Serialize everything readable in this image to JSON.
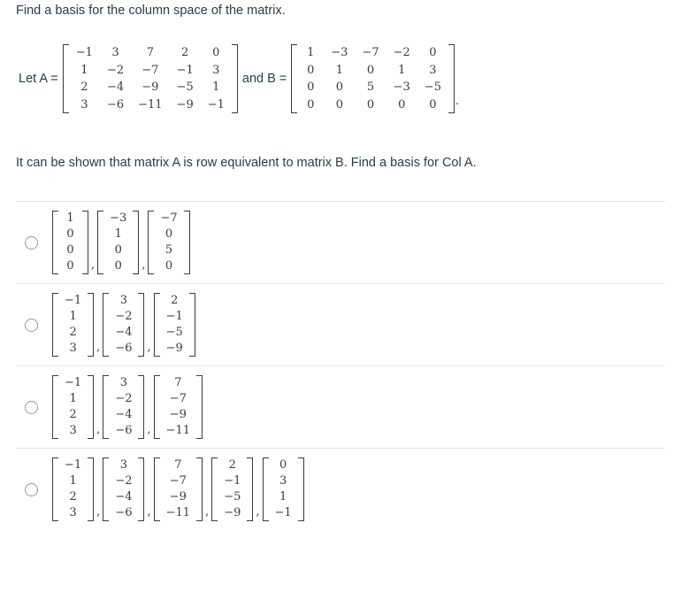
{
  "prompt": {
    "title": "Find a basis for the column space of the matrix.",
    "instruction": "It can be shown that matrix A is row equivalent to matrix B. Find a basis for Col A."
  },
  "definition": {
    "let_label": "Let A =",
    "and_label": "and B =",
    "period": ".",
    "matrix_a": [
      [
        "−1",
        "3",
        "7",
        "2",
        "0"
      ],
      [
        "1",
        "−2",
        "−7",
        "−1",
        "3"
      ],
      [
        "2",
        "−4",
        "−9",
        "−5",
        "1"
      ],
      [
        "3",
        "−6",
        "−11",
        "−9",
        "−1"
      ]
    ],
    "matrix_b": [
      [
        "1",
        "−3",
        "−7",
        "−2",
        "0"
      ],
      [
        "0",
        "1",
        "0",
        "1",
        "3"
      ],
      [
        "0",
        "0",
        "5",
        "−3",
        "−5"
      ],
      [
        "0",
        "0",
        "0",
        "0",
        "0"
      ]
    ]
  },
  "separator": ",",
  "choices": [
    {
      "selected": false,
      "vectors": [
        [
          "1",
          "0",
          "0",
          "0"
        ],
        [
          "−3",
          "1",
          "0",
          "0"
        ],
        [
          "−7",
          "0",
          "5",
          "0"
        ]
      ]
    },
    {
      "selected": false,
      "vectors": [
        [
          "−1",
          "1",
          "2",
          "3"
        ],
        [
          "3",
          "−2",
          "−4",
          "−6"
        ],
        [
          "2",
          "−1",
          "−5",
          "−9"
        ]
      ]
    },
    {
      "selected": false,
      "vectors": [
        [
          "−1",
          "1",
          "2",
          "3"
        ],
        [
          "3",
          "−2",
          "−4",
          "−6"
        ],
        [
          "7",
          "−7",
          "−9",
          "−11"
        ]
      ]
    },
    {
      "selected": false,
      "vectors": [
        [
          "−1",
          "1",
          "2",
          "3"
        ],
        [
          "3",
          "−2",
          "−4",
          "−6"
        ],
        [
          "7",
          "−7",
          "−9",
          "−11"
        ],
        [
          "2",
          "−1",
          "−5",
          "−9"
        ],
        [
          "0",
          "3",
          "1",
          "−1"
        ]
      ]
    }
  ],
  "colors": {
    "text": "#2d3b45",
    "matrix_text": "#3a3a3a",
    "divider": "#e3e3e3",
    "radio_border": "#9a9a9a"
  }
}
